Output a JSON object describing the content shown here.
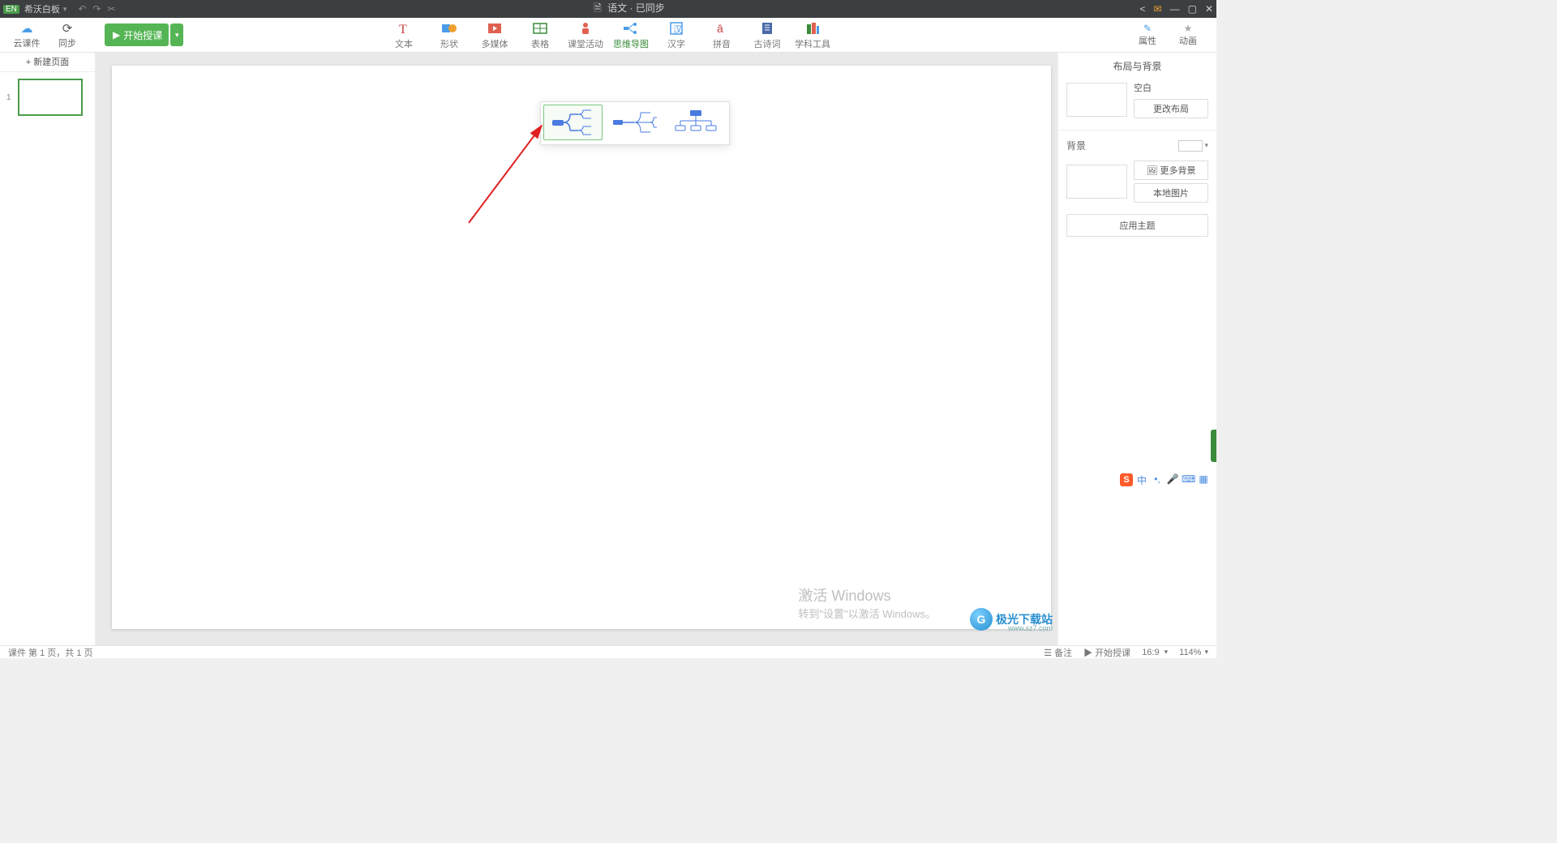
{
  "titlebar": {
    "badge": "EN",
    "app_name": "希沃白板",
    "doc_title": "语文 · 已同步"
  },
  "toolbar": {
    "cloud": "云课件",
    "sync": "同步",
    "start": "开始授课"
  },
  "tools": {
    "text": "文本",
    "shape": "形状",
    "media": "多媒体",
    "table": "表格",
    "activity": "课堂活动",
    "mindmap": "思维导图",
    "hanzi": "汉字",
    "pinyin": "拼音",
    "poem": "古诗词",
    "subject": "学科工具"
  },
  "right_tools": {
    "props": "属性",
    "anim": "动画"
  },
  "sidebar": {
    "new_page": "+ 新建页面",
    "page_num": "1"
  },
  "rightpanel": {
    "title": "布局与背景",
    "blank": "空白",
    "change_layout": "更改布局",
    "bg": "背景",
    "more_bg": "更多背景",
    "local_img": "本地图片",
    "apply_theme": "应用主题",
    "more_bg_icon": "🖼"
  },
  "status": {
    "pages": "课件 第 1 页，共 1 页",
    "notes": "备注",
    "start": "开始授课",
    "ratio": "16:9",
    "zoom": "114%"
  },
  "watermark": {
    "line1": "激活 Windows",
    "line2": "转到\"设置\"以激活 Windows。"
  },
  "logo": {
    "text": "极光下载站",
    "sub": "www.xz7.com"
  },
  "ime": {
    "s": "S",
    "zh": "中"
  }
}
